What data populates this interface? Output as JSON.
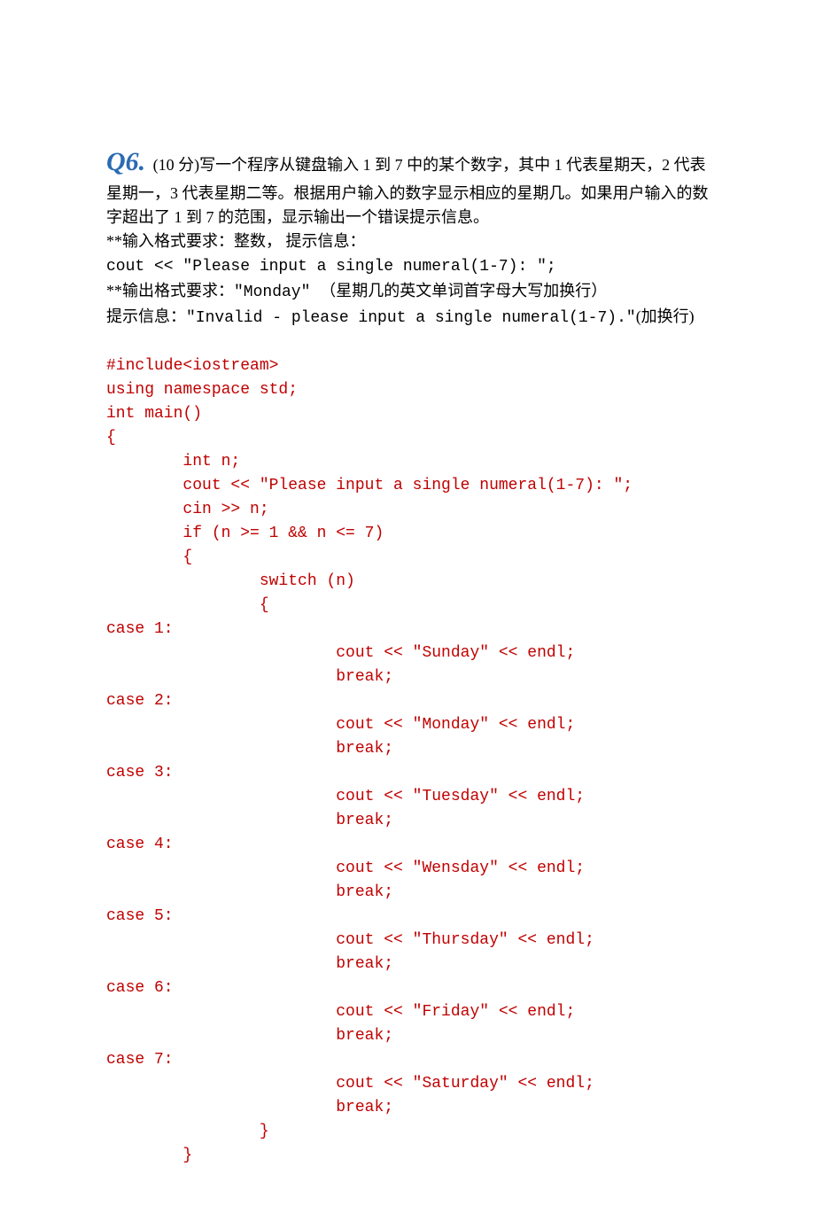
{
  "heading": {
    "label": "Q6.",
    "points": "(10 分)",
    "desc1": "写一个程序从键盘输入 1 到 7 中的某个数字，其中 1 代表星期天，2 代表星期一，3 代表星期二等。根据用户输入的数字显示相应的星期几。如果用户输入的数字超出了 1 到 7 的范围，显示输出一个错误提示信息。"
  },
  "input_spec": {
    "prefix": "**输入格式要求：整数，  提示信息：",
    "mono": "cout << \"Please input a single numeral(1-7): \";"
  },
  "output_spec": {
    "line1_prefix": "**输出格式要求：",
    "line1_mono": "\"Monday\" ",
    "line1_suffix": "（星期几的英文单词首字母大写加换行）",
    "line2_prefix": "提示信息：",
    "line2_mono": "\"Invalid - please input a single numeral(1-7).\"",
    "line2_suffix": "(加换行)"
  },
  "code": {
    "l1": "#include<iostream>",
    "l2": "using namespace std;",
    "l3": "int main()",
    "l4": "{",
    "l5": "        int n;",
    "l6": "        cout << \"Please input a single numeral(1-7): \";",
    "l7": "        cin >> n;",
    "l8": "        if (n >= 1 && n <= 7)",
    "l9": "        {",
    "l10": "                switch (n)",
    "l11": "                {",
    "l12": "case 1:",
    "l13": "                        cout << \"Sunday\" << endl;",
    "l14": "                        break;",
    "l15": "case 2:",
    "l16": "                        cout << \"Monday\" << endl;",
    "l17": "                        break;",
    "l18": "case 3:",
    "l19": "                        cout << \"Tuesday\" << endl;",
    "l20": "                        break;",
    "l21": "case 4:",
    "l22": "                        cout << \"Wensday\" << endl;",
    "l23": "                        break;",
    "l24": "case 5:",
    "l25": "                        cout << \"Thursday\" << endl;",
    "l26": "                        break;",
    "l27": "case 6:",
    "l28": "                        cout << \"Friday\" << endl;",
    "l29": "                        break;",
    "l30": "case 7:",
    "l31": "                        cout << \"Saturday\" << endl;",
    "l32": "                        break;",
    "l33": "                }",
    "l34": "        }"
  }
}
